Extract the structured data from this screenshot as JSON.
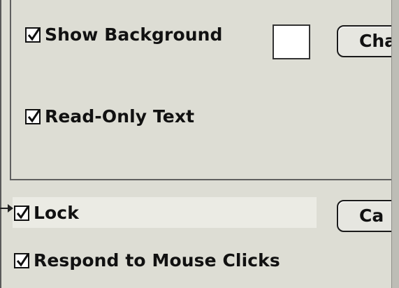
{
  "group": {
    "show_background": {
      "label": "Show Background",
      "checked": true
    },
    "read_only_text": {
      "label": "Read-Only Text",
      "checked": true
    },
    "swatch_color": "#ffffff",
    "change_button_label": "Cha"
  },
  "options": {
    "lock": {
      "label": "Lock",
      "checked": true
    },
    "respond_mouse": {
      "label": "Respond to Mouse Clicks",
      "checked": true
    },
    "cancel_button_label": "Ca"
  }
}
